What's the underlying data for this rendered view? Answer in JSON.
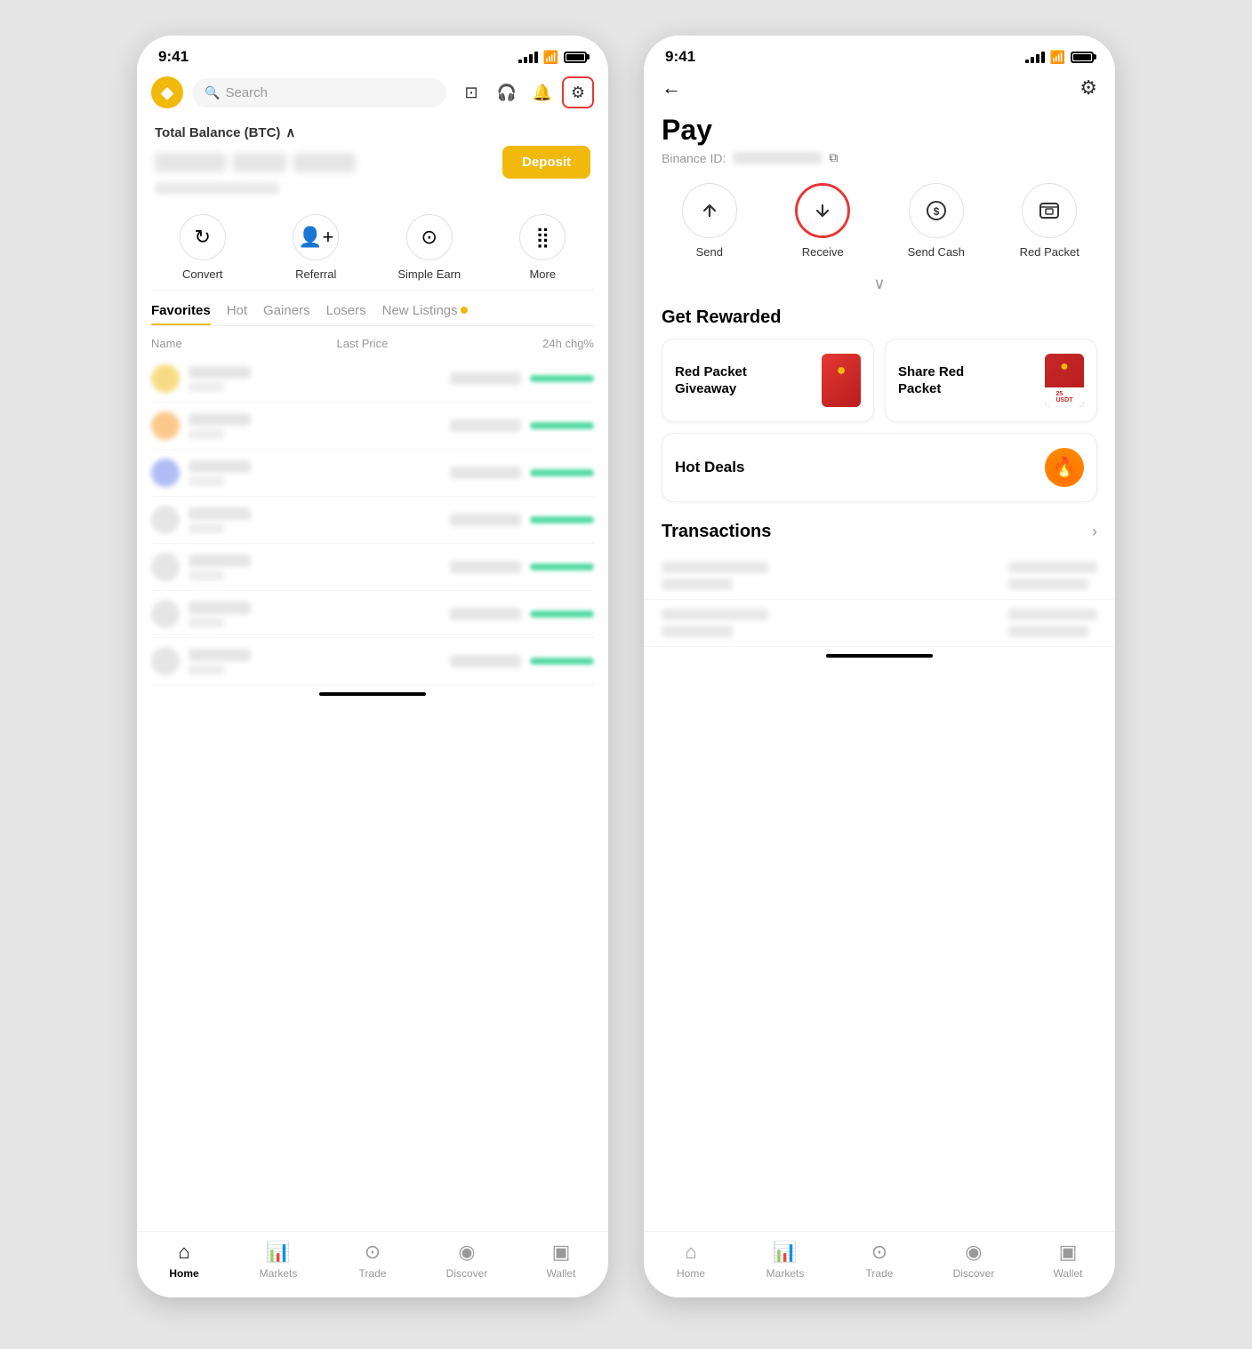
{
  "phones": {
    "left": {
      "status_time": "9:41",
      "header": {
        "search_placeholder": "Search"
      },
      "balance": {
        "title": "Total Balance (BTC)",
        "deposit_label": "Deposit"
      },
      "quick_actions": [
        {
          "id": "convert",
          "label": "Convert",
          "icon": "↻"
        },
        {
          "id": "referral",
          "label": "Referral",
          "icon": "👤"
        },
        {
          "id": "simple-earn",
          "label": "Simple Earn",
          "icon": "⊙"
        },
        {
          "id": "more",
          "label": "More",
          "icon": "⣿"
        }
      ],
      "tabs": [
        {
          "id": "favorites",
          "label": "Favorites",
          "active": true
        },
        {
          "id": "hot",
          "label": "Hot",
          "active": false
        },
        {
          "id": "gainers",
          "label": "Gainers",
          "active": false
        },
        {
          "id": "losers",
          "label": "Losers",
          "active": false
        },
        {
          "id": "new-listings",
          "label": "New Listings",
          "active": false,
          "badge": true
        }
      ],
      "table_headers": {
        "name": "Name",
        "last_price": "Last Price",
        "change": "24h chg%"
      },
      "market_rows": [
        1,
        2,
        3,
        4,
        5,
        6,
        7
      ]
    },
    "right": {
      "status_time": "9:41",
      "page_title": "Pay",
      "binance_id_label": "Binance ID:",
      "pay_actions": [
        {
          "id": "send",
          "label": "Send",
          "icon": "↑",
          "highlighted": false
        },
        {
          "id": "receive",
          "label": "Receive",
          "icon": "↓",
          "highlighted": true
        },
        {
          "id": "send-cash",
          "label": "Send Cash",
          "icon": "$",
          "highlighted": false
        },
        {
          "id": "red-packet",
          "label": "Red Packet",
          "icon": "▦",
          "highlighted": false
        }
      ],
      "get_rewarded_title": "Get Rewarded",
      "rewards": [
        {
          "id": "red-packet-giveaway",
          "label": "Red Packet Giveaway"
        },
        {
          "id": "share-red-packet",
          "label": "Share Red Packet"
        }
      ],
      "hot_deals_label": "Hot Deals",
      "transactions_title": "Transactions",
      "transaction_rows": [
        1,
        2
      ]
    }
  },
  "bottom_nav": {
    "left": [
      {
        "id": "home",
        "label": "Home",
        "icon": "⌂",
        "active": true
      },
      {
        "id": "markets",
        "label": "Markets",
        "icon": "📊",
        "active": false
      },
      {
        "id": "trade",
        "label": "Trade",
        "icon": "⊙",
        "active": false
      },
      {
        "id": "discover",
        "label": "Discover",
        "icon": "◉",
        "active": false
      },
      {
        "id": "wallet",
        "label": "Wallet",
        "icon": "▣",
        "active": false
      }
    ]
  }
}
